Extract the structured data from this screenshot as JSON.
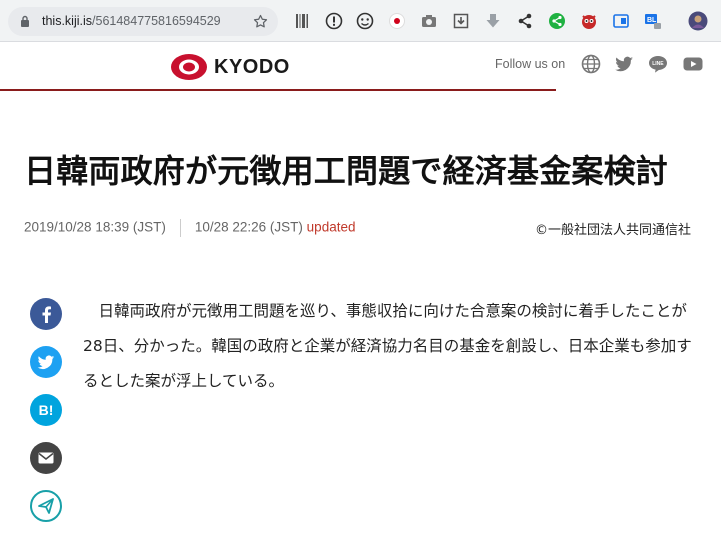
{
  "browser": {
    "url_host": "this.kiji.is",
    "url_path": "/561484775816594529"
  },
  "header": {
    "logo_text": "KYODO",
    "follow_label": "Follow us on"
  },
  "article": {
    "title": "日韓両政府が元徴用工問題で経済基金案検討",
    "published": "2019/10/28 18:39 (JST)",
    "updated_time": "10/28 22:26 (JST)",
    "updated_label": "updated",
    "copyright": "©一般社団法人共同通信社",
    "body_lines": [
      "日韓両政府が元徴用工問題を巡り、事態収拾に向けた合意案の検討に着手した",
      "ことが28日、分かった。韓国の政府と企業が経済協力名目の基金を創設し、日本",
      "企業も参加するとした案が浮上している。"
    ]
  },
  "share": {
    "hatena_label": "B!"
  },
  "colors": {
    "facebook": "#3b5998",
    "twitter": "#1da1f2",
    "hatena": "#00a4de",
    "mail": "#444444",
    "line_teal": "#18a0a8",
    "accent_red": "#c0392b",
    "header_line": "#8a1c1c"
  }
}
